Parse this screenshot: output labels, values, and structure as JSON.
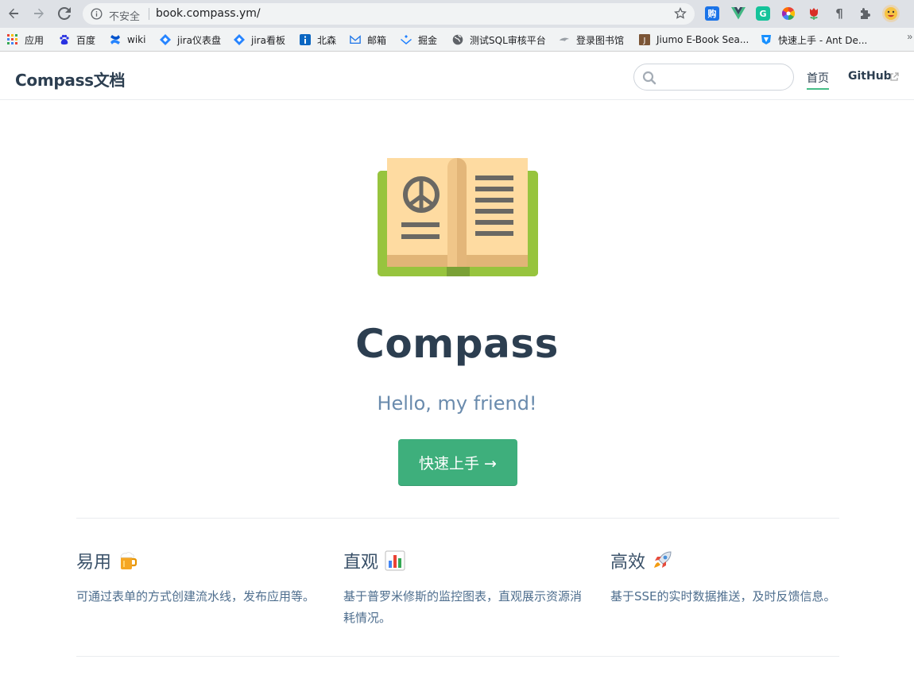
{
  "browser": {
    "insecure_label": "不安全",
    "url": "book.compass.ym/",
    "extensions": [
      "购",
      "V",
      "G",
      "color-wheel",
      "flower",
      "¶",
      "puzzle",
      "avatar"
    ]
  },
  "bookmarks": [
    {
      "label": "应用",
      "icon": "apps-grid-icon"
    },
    {
      "label": "百度",
      "icon": "baidu-paw-icon"
    },
    {
      "label": "wiki",
      "icon": "confluence-icon"
    },
    {
      "label": "jira仪表盘",
      "icon": "jira-icon"
    },
    {
      "label": "jira看板",
      "icon": "jira-icon"
    },
    {
      "label": "北森",
      "icon": "info-square-icon"
    },
    {
      "label": "邮箱",
      "icon": "mail-logo-icon"
    },
    {
      "label": "掘金",
      "icon": "juejin-icon"
    },
    {
      "label": "测试SQL审核平台",
      "icon": "globe-icon"
    },
    {
      "label": "登录图书馆",
      "icon": "library-icon"
    },
    {
      "label": "Jiumo E-Book Sea...",
      "icon": "jiumo-icon"
    },
    {
      "label": "快速上手 - Ant De...",
      "icon": "vue-shield-icon"
    }
  ],
  "navbar": {
    "site_title": "Compass文档",
    "search_placeholder": "",
    "links": {
      "home": "首页",
      "github": "GitHub"
    }
  },
  "hero": {
    "title": "Compass",
    "description": "Hello, my friend!",
    "action": "快速上手 →"
  },
  "features": [
    {
      "title": "易用",
      "emoji": "beer-icon",
      "desc": "可通过表单的方式创建流水线，发布应用等。"
    },
    {
      "title": "直观",
      "emoji": "bar-chart-icon",
      "desc": "基于普罗米修斯的监控图表，直观展示资源消耗情况。"
    },
    {
      "title": "高效",
      "emoji": "rocket-icon",
      "desc": "基于SSE的实时数据推送，及时反馈信息。"
    }
  ],
  "colors": {
    "accent": "#3eaf7c",
    "text": "#2c3e50",
    "description": "#6a8bad"
  }
}
